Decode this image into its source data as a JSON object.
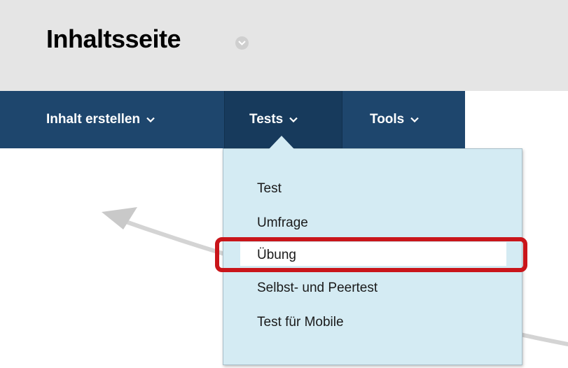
{
  "page": {
    "title": "Inhaltsseite"
  },
  "navbar": {
    "items": [
      {
        "label": "Inhalt erstellen"
      },
      {
        "label": "Tests"
      },
      {
        "label": "Tools"
      }
    ]
  },
  "dropdown": {
    "items": [
      {
        "label": "Test"
      },
      {
        "label": "Umfrage"
      },
      {
        "label": "Übung"
      },
      {
        "label": "Selbst- und Peertest"
      },
      {
        "label": "Test für Mobile"
      }
    ],
    "highlighted_item": "Übung"
  },
  "colors": {
    "header_bg": "#e5e5e5",
    "navbar_bg": "#1e466d",
    "dropdown_bg": "#d4ebf3",
    "highlight": "#c9151a"
  },
  "icons": {
    "title_menu": "chevron-down-circle-icon",
    "nav_chevron": "chevron-down-icon"
  }
}
